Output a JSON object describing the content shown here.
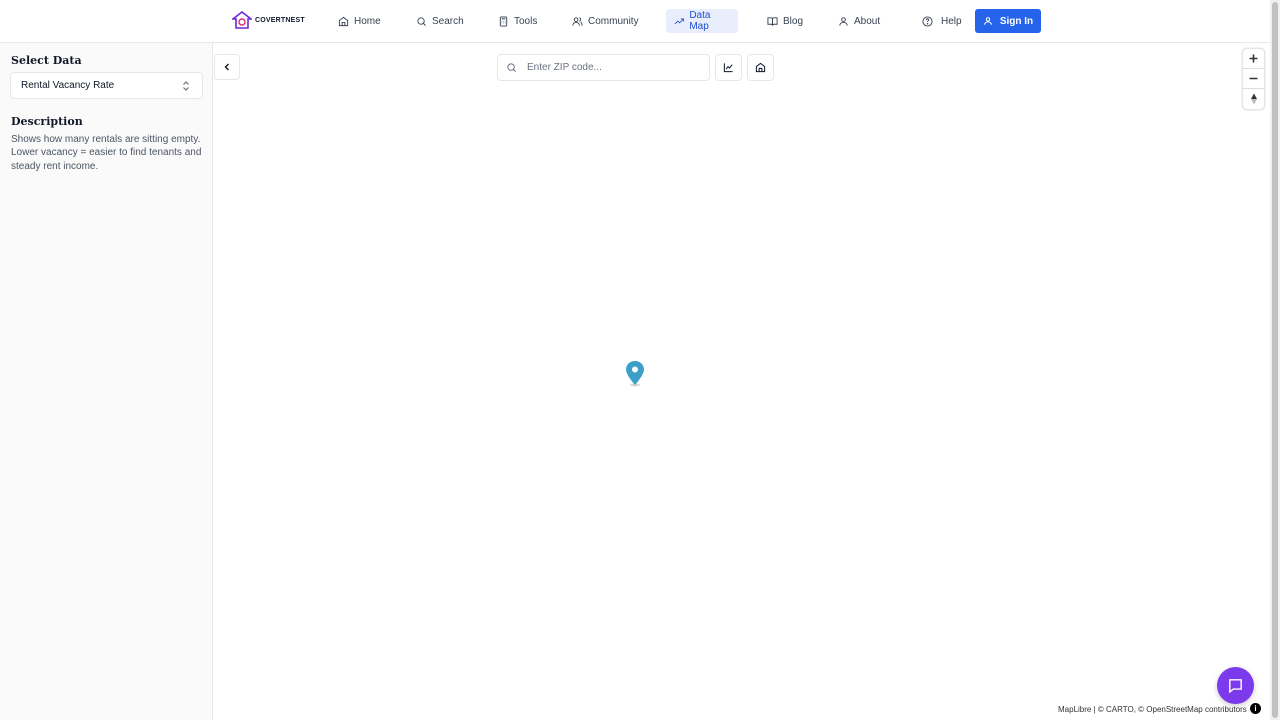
{
  "header": {
    "logo_text": "COVERTNEST",
    "nav": [
      {
        "label": "Home",
        "icon": "home-icon"
      },
      {
        "label": "Search",
        "icon": "search-icon"
      },
      {
        "label": "Tools",
        "icon": "calculator-icon"
      },
      {
        "label": "Community",
        "icon": "users-icon"
      },
      {
        "label": "Data Map",
        "icon": "trending-up-icon",
        "active": true
      },
      {
        "label": "Blog",
        "icon": "book-icon"
      },
      {
        "label": "About",
        "icon": "user-icon"
      }
    ],
    "help_label": "Help",
    "signin_label": "Sign In"
  },
  "sidebar": {
    "select_title": "Select Data",
    "selected_dataset": "Rental Vacancy Rate",
    "description_title": "Description",
    "description_text": "Shows how many rentals are sitting empty. Lower vacancy = easier to find tenants and steady rent income."
  },
  "map": {
    "zip_placeholder": "Enter ZIP code...",
    "attribution": "MapLibre | © CARTO, © OpenStreetMap contributors",
    "info_label": "i"
  },
  "colors": {
    "accent": "#2563eb",
    "active_nav_bg": "#e8eefb",
    "chat_button": "#7c3aed",
    "pin": "#3aa0c8"
  }
}
